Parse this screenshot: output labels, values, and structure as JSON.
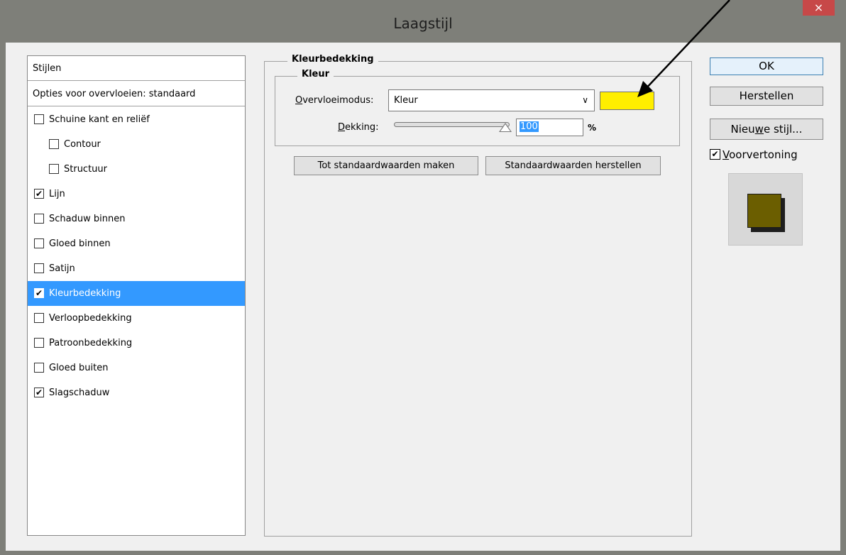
{
  "window": {
    "title": "Laagstijl",
    "close_glyph": "×"
  },
  "sidebar": {
    "header_stijlen": "Stijlen",
    "header_options": "Opties voor overvloeien: standaard",
    "items": [
      {
        "label": "Schuine kant en reliëf",
        "checked": false,
        "indent": false,
        "selected": false
      },
      {
        "label": "Contour",
        "checked": false,
        "indent": true,
        "selected": false
      },
      {
        "label": "Structuur",
        "checked": false,
        "indent": true,
        "selected": false
      },
      {
        "label": "Lijn",
        "checked": true,
        "indent": false,
        "selected": false
      },
      {
        "label": "Schaduw binnen",
        "checked": false,
        "indent": false,
        "selected": false
      },
      {
        "label": "Gloed binnen",
        "checked": false,
        "indent": false,
        "selected": false
      },
      {
        "label": "Satijn",
        "checked": false,
        "indent": false,
        "selected": false
      },
      {
        "label": "Kleurbedekking",
        "checked": true,
        "indent": false,
        "selected": true
      },
      {
        "label": "Verloopbedekking",
        "checked": false,
        "indent": false,
        "selected": false
      },
      {
        "label": "Patroonbedekking",
        "checked": false,
        "indent": false,
        "selected": false
      },
      {
        "label": "Gloed buiten",
        "checked": false,
        "indent": false,
        "selected": false
      },
      {
        "label": "Slagschaduw",
        "checked": true,
        "indent": false,
        "selected": false
      }
    ]
  },
  "panel": {
    "group_title": "Kleurbedekking",
    "subgroup_title": "Kleur",
    "blend_mode_label_first": "O",
    "blend_mode_label_rest": "vervloeimodus:",
    "blend_mode_value": "Kleur",
    "opacity_label_first": "D",
    "opacity_label_rest": "ekking:",
    "opacity_value": "100",
    "opacity_unit": "%",
    "opacity_level": 100,
    "overlay_color": "#ffee00",
    "btn_make_default": "Tot standaardwaarden maken",
    "btn_reset_default": "Standaardwaarden herstellen"
  },
  "actions": {
    "ok": "OK",
    "reset": "Herstellen",
    "new_style_before": "Nieu",
    "new_style_underlined": "w",
    "new_style_after": "e stijl...",
    "preview_first": "V",
    "preview_rest": "oorvertoning",
    "preview_checked": true
  },
  "colors": {
    "selection": "#3399ff",
    "preview_swatch": "#6b5e00",
    "close_button": "#c74848"
  }
}
